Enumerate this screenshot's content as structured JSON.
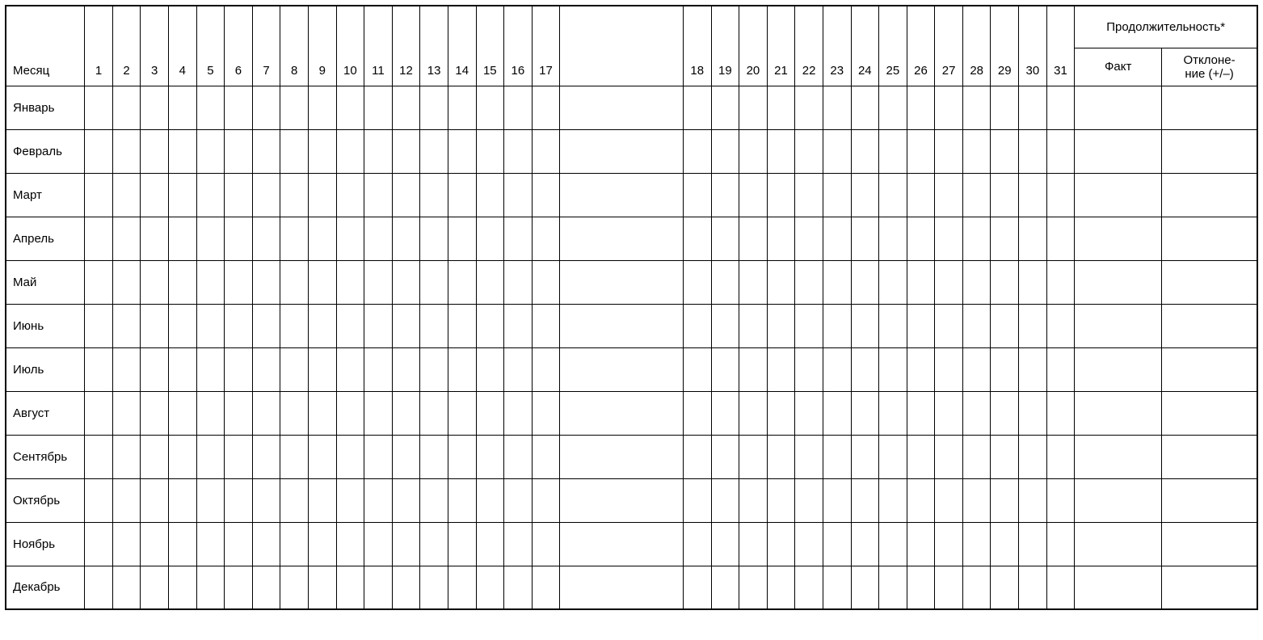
{
  "header": {
    "month_label": "Месяц",
    "days_left": [
      "1",
      "2",
      "3",
      "4",
      "5",
      "6",
      "7",
      "8",
      "9",
      "10",
      "11",
      "12",
      "13",
      "14",
      "15",
      "16",
      "17"
    ],
    "gap_label": "",
    "days_right": [
      "18",
      "19",
      "20",
      "21",
      "22",
      "23",
      "24",
      "25",
      "26",
      "27",
      "28",
      "29",
      "30",
      "31"
    ],
    "duration_label": "Продолжительность*",
    "fact_label": "Факт",
    "deviation_label": "Отклоне-\nние (+/–)"
  },
  "months": [
    {
      "name": "Январь"
    },
    {
      "name": "Февраль"
    },
    {
      "name": "Март"
    },
    {
      "name": "Апрель"
    },
    {
      "name": "Май"
    },
    {
      "name": "Июнь"
    },
    {
      "name": "Июль"
    },
    {
      "name": "Август"
    },
    {
      "name": "Сентябрь"
    },
    {
      "name": "Октябрь"
    },
    {
      "name": "Ноябрь"
    },
    {
      "name": "Декабрь"
    }
  ]
}
